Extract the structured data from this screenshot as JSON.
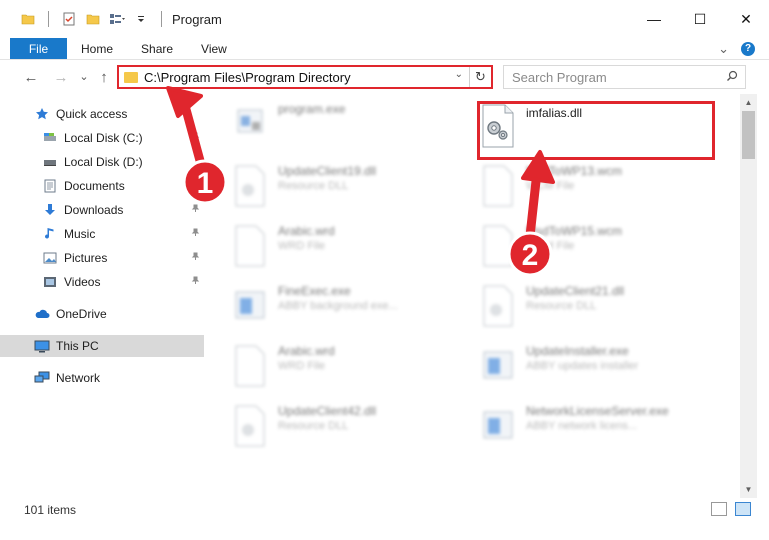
{
  "window": {
    "title": "Program",
    "minimize_glyph": "—",
    "maximize_glyph": "☐",
    "close_glyph": "✕"
  },
  "ribbon": {
    "tabs": [
      {
        "label": "File"
      },
      {
        "label": "Home"
      },
      {
        "label": "Share"
      },
      {
        "label": "View"
      }
    ],
    "expand_glyph": "⌄",
    "help_glyph": "?"
  },
  "navigation": {
    "back_glyph": "←",
    "forward_glyph": "→",
    "recent_glyph": "⌄",
    "up_glyph": "↑"
  },
  "address": {
    "path": "C:\\Program Files\\Program Directory",
    "dropdown_glyph": "⌄",
    "refresh_glyph": "↻"
  },
  "search": {
    "placeholder": "Search Program",
    "icon": "search-icon"
  },
  "sidebar": {
    "items": [
      {
        "label": "Quick access",
        "icon": "star-icon",
        "pinned": false
      },
      {
        "label": "Local Disk (C:)",
        "icon": "drive-icon",
        "pinned": true
      },
      {
        "label": "Local Disk (D:)",
        "icon": "drive-icon",
        "pinned": false
      },
      {
        "label": "Documents",
        "icon": "documents-icon",
        "pinned": true
      },
      {
        "label": "Downloads",
        "icon": "download-icon",
        "pinned": true
      },
      {
        "label": "Music",
        "icon": "music-icon",
        "pinned": true
      },
      {
        "label": "Pictures",
        "icon": "pictures-icon",
        "pinned": true
      },
      {
        "label": "Videos",
        "icon": "videos-icon",
        "pinned": true
      },
      {
        "label": "OneDrive",
        "icon": "cloud-icon",
        "pinned": false
      },
      {
        "label": "This PC",
        "icon": "computer-icon",
        "pinned": false,
        "selected": true
      },
      {
        "label": "Network",
        "icon": "network-icon",
        "pinned": false
      }
    ],
    "pin_glyph": "📌"
  },
  "files": [
    {
      "name": "program.exe",
      "type": "",
      "icon": "exe-icon",
      "blurred": true
    },
    {
      "name": "imfalias.dll",
      "type": "",
      "icon": "dll-gear-icon",
      "blurred": false,
      "highlighted": true
    },
    {
      "name": "UpdateClient19.dll",
      "type": "Resource DLL",
      "icon": "dll-icon",
      "blurred": true
    },
    {
      "name": "MsdToWP13.wcm",
      "type": "WCM File",
      "icon": "file-icon",
      "blurred": true
    },
    {
      "name": "Arabic.wrd",
      "type": "WRD File",
      "icon": "file-icon",
      "blurred": true
    },
    {
      "name": "MsdToWP15.wcm",
      "type": "WCM File",
      "icon": "file-icon",
      "blurred": true
    },
    {
      "name": "FineExec.exe",
      "type": "ABBY background exe...",
      "icon": "app-icon",
      "blurred": true
    },
    {
      "name": "UpdateClient21.dll",
      "type": "Resource DLL",
      "icon": "dll-icon",
      "blurred": true
    },
    {
      "name": "Arabic.wrd",
      "type": "WRD File",
      "icon": "file-icon",
      "blurred": true
    },
    {
      "name": "UpdateInstaller.exe",
      "type": "ABBY updates installer",
      "icon": "app-icon",
      "blurred": true
    },
    {
      "name": "UpdateClient42.dll",
      "type": "Resource DLL",
      "icon": "dll-icon",
      "blurred": true
    },
    {
      "name": "NetworkLicenseServer.exe",
      "type": "ABBY network licens...",
      "icon": "app-icon",
      "blurred": true
    }
  ],
  "status": {
    "item_count": "101 items"
  },
  "annotations": {
    "step1": "1",
    "step2": "2",
    "color": "#e0262d"
  },
  "colors": {
    "accent": "#1979ca",
    "highlight": "#e0262d",
    "folder": "#f5c84a"
  }
}
